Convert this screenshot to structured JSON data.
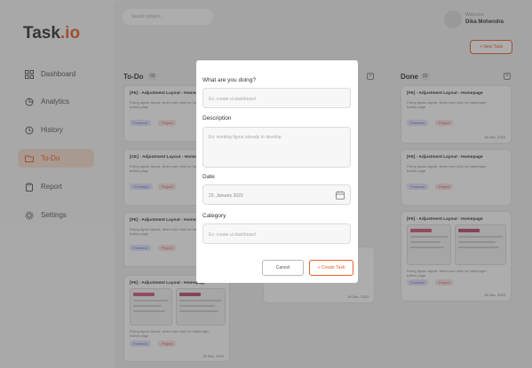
{
  "brand": {
    "name": "Task",
    "suffix": ".io",
    "accent": "#e8602c"
  },
  "sidebar": {
    "items": [
      {
        "label": "Dashboard",
        "icon": "grid-icon"
      },
      {
        "label": "Analytics",
        "icon": "pie-chart-icon"
      },
      {
        "label": "History",
        "icon": "clock-icon"
      },
      {
        "label": "To-Do",
        "icon": "folder-icon",
        "active": true
      },
      {
        "label": "Report",
        "icon": "clipboard-icon"
      },
      {
        "label": "Settings",
        "icon": "gear-icon"
      }
    ]
  },
  "header": {
    "search_placeholder": "Search project...",
    "welcome": "Welcome",
    "username": "Dika Mohendra",
    "new_task": "+ New Task"
  },
  "columns": {
    "todo": {
      "title": "To-Do",
      "count": "03"
    },
    "done": {
      "title": "Done",
      "count": "02"
    }
  },
  "cards": {
    "todo": [
      {
        "title": "[FE] - Adjustment Layout - Homepage",
        "desc": "Fixing layout layout, when user click on hamburger button page",
        "tags": [
          "Frontend",
          "Project"
        ]
      },
      {
        "title": "[CE] - Adjustment Layout - Homepage",
        "desc": "Fixing layout layout, when user click on hamburger button page",
        "tags": [
          "UI Design",
          "Project"
        ]
      },
      {
        "title": "[FE] - Adjustment Layout - Homepage",
        "desc": "Fixing layout layout, when user click on hamburger button page",
        "tags": [
          "Frontend",
          "Project"
        ]
      },
      {
        "title": "[FE] - Adjustment Layout - Homepage",
        "desc": "Fixing layout layout, when user click on hamburger button page",
        "tags": [
          "Frontend",
          "Project"
        ],
        "date": "15 Dec, 2023"
      }
    ],
    "middle_date": "15 Dec, 2023",
    "done": [
      {
        "title": "[FE] - Adjustment Layout - Homepage",
        "desc": "Fixing layout layout, when user click on hamburger button page",
        "tags": [
          "Frontend",
          "Project"
        ],
        "date": "15 Dec, 2023"
      },
      {
        "title": "[FE] - Adjustment Layout - Homepage",
        "desc": "Fixing layout layout, when user click on hamburger button page",
        "tags": [
          "Frontend",
          "Project"
        ]
      },
      {
        "title": "[FE] - Adjustment Layout - Homepage",
        "desc": "Fixing layout layout, when user click on hamburger button page",
        "tags": [
          "Frontend",
          "Project"
        ],
        "date": "15 Dec, 2023"
      }
    ]
  },
  "modal": {
    "what_label": "What are you doing?",
    "what_placeholder": "Ex: create ui dashboard",
    "description_label": "Description",
    "description_placeholder": "Ex: working figma already to develop",
    "date_label": "Date",
    "date_value": "22, January 2023",
    "category_label": "Category",
    "category_placeholder": "Ex: create ui dashboard",
    "cancel": "Cancel",
    "create": "+ Create Task"
  }
}
